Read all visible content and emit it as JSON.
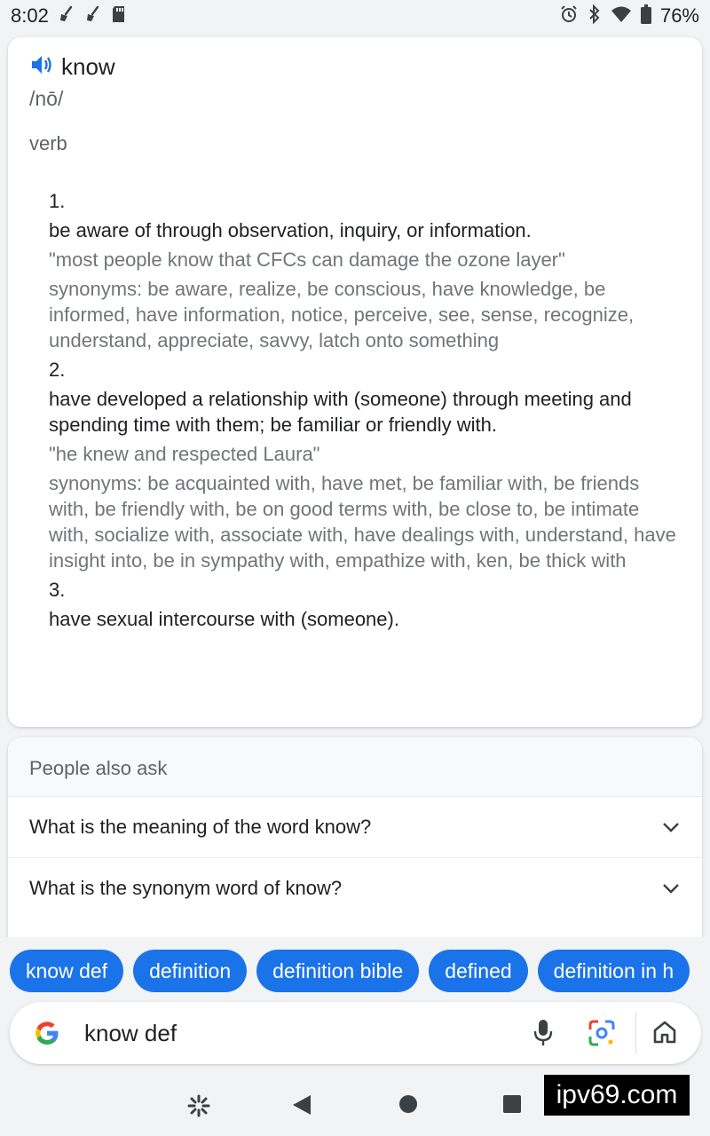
{
  "status_bar": {
    "time": "8:02",
    "battery": "76%"
  },
  "dictionary": {
    "word": "know",
    "phonetic": "/nō/",
    "part_of_speech": "verb",
    "senses": [
      {
        "number": "1.",
        "definition": "be aware of through observation, inquiry, or information.",
        "example": "\"most people know that CFCs can damage the ozone layer\"",
        "synonyms": "synonyms: be aware, realize, be conscious, have knowledge, be informed, have information, notice, perceive, see, sense, recognize, understand, appreciate, savvy, latch onto something"
      },
      {
        "number": "2.",
        "definition": "have developed a relationship with (someone) through meeting and spending time with them; be familiar or friendly with.",
        "example": "\"he knew and respected Laura\"",
        "synonyms": "synonyms: be acquainted with, have met, be familiar with, be friends with, be friendly with, be on good terms with, be close to, be intimate with, socialize with, associate with, have dealings with, understand, have insight into, be in sympathy with, empathize with, ken, be thick with"
      },
      {
        "number": "3.",
        "definition": "have sexual intercourse with (someone)."
      }
    ]
  },
  "people_also_ask": {
    "title": "People also ask",
    "questions": [
      "What is the meaning of the word know?",
      "What is the synonym word of know?"
    ]
  },
  "suggestion_chips": [
    "know def",
    "definition",
    "definition bible",
    "defined",
    "definition in h"
  ],
  "search": {
    "query": "know def"
  },
  "watermark": "ipv69.com",
  "colors": {
    "accent": "#1a73e8",
    "secondary_text": "#70757a"
  }
}
